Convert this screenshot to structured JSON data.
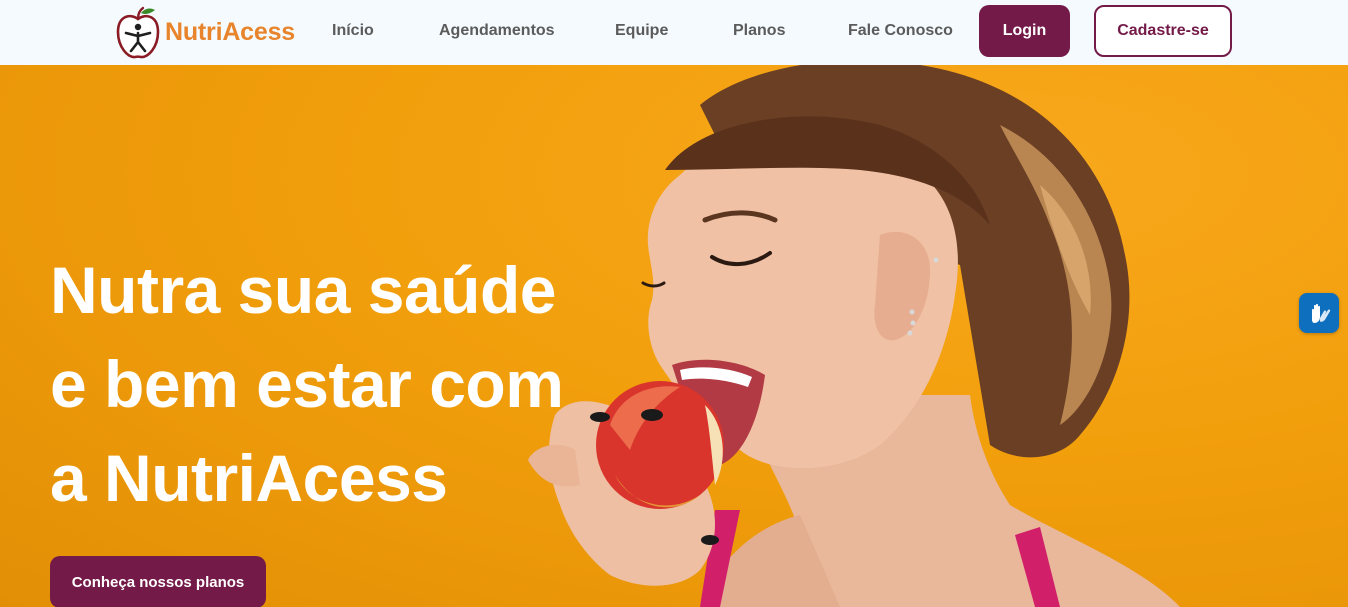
{
  "brand": {
    "name": "NutriAcess",
    "logo_icon": "apple-person-icon",
    "accent": "#731a48",
    "logo_color": "#e8842b"
  },
  "nav": {
    "items": [
      {
        "label": "Início"
      },
      {
        "label": "Agendamentos"
      },
      {
        "label": "Equipe"
      },
      {
        "label": "Planos"
      },
      {
        "label": "Fale Conosco"
      }
    ],
    "login_label": "Login",
    "signup_label": "Cadastre-se"
  },
  "hero": {
    "title_lines": [
      "Nutra sua saúde",
      "e bem estar com",
      "a NutriAcess"
    ],
    "cta_label": "Conheça nossos planos",
    "background": "#f29f0c",
    "image_subject": "woman-biting-apple"
  },
  "accessibility": {
    "icon": "sign-language-hands-icon",
    "color": "#0f6fbf"
  }
}
